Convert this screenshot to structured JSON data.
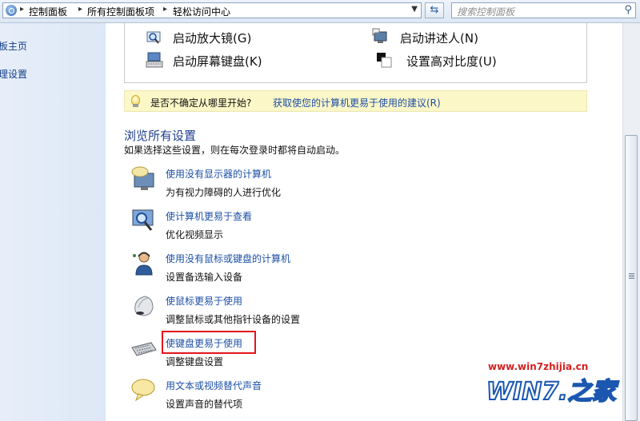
{
  "address": {
    "crumbs": [
      "控制面板",
      "所有控制面板项",
      "轻松访问中心"
    ],
    "search_placeholder": "搜索控制面板"
  },
  "left_nav": [
    "板主页",
    "理设置"
  ],
  "quick_access": [
    {
      "label": "启动放大镜(G)",
      "icon": "magnifier-icon"
    },
    {
      "label": "启动讲述人(N)",
      "icon": "narrator-icon"
    },
    {
      "label": "启动屏幕键盘(K)",
      "icon": "onscreen-keyboard-icon"
    },
    {
      "label": "设置高对比度(U)",
      "icon": "high-contrast-icon"
    }
  ],
  "tip": {
    "question": "是否不确定从哪里开始?",
    "link": "获取使您的计算机更易于使用的建议(R)"
  },
  "section": {
    "title": "浏览所有设置",
    "description": "如果选择这些设置，则在每次登录时都将自动启动。"
  },
  "options": [
    {
      "link": "使用没有显示器的计算机",
      "desc": "为有视力障碍的人进行优化",
      "icon": "monitor-speech-icon"
    },
    {
      "link": "使计算机更易于查看",
      "desc": "优化视频显示",
      "icon": "monitor-magnifier-icon"
    },
    {
      "link": "使用没有鼠标或键盘的计算机",
      "desc": "设置备选输入设备",
      "icon": "person-headset-icon"
    },
    {
      "link": "使鼠标更易于使用",
      "desc": "调整鼠标或其他指针设备的设置",
      "icon": "mouse-icon"
    },
    {
      "link": "使键盘更易于使用",
      "desc": "调整键盘设置",
      "icon": "keyboard-icon"
    },
    {
      "link": "用文本或视频替代声音",
      "desc": "设置声音的替代项",
      "icon": "speech-bubble-icon"
    }
  ],
  "watermark": {
    "url": "www.win7zhijia.cn",
    "logo": "WIN7.之家"
  },
  "colors": {
    "link": "#1c4fa6",
    "title": "#1f3f8c",
    "highlight": "#e3141b",
    "tip_bg": "#fcf7c7"
  }
}
